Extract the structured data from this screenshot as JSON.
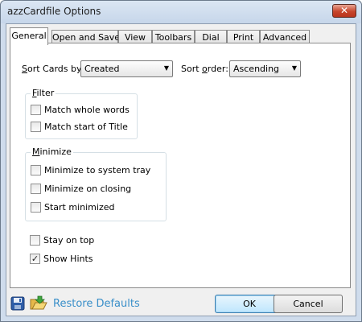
{
  "window": {
    "title": "azzCardfile Options",
    "close_glyph": "✕"
  },
  "tabs": [
    {
      "label": "General"
    },
    {
      "label": "Open and Save"
    },
    {
      "label": "View"
    },
    {
      "label": "Toolbars"
    },
    {
      "label": "Dial"
    },
    {
      "label": "Print"
    },
    {
      "label": "Advanced"
    }
  ],
  "general": {
    "sort_cards": {
      "label_u": "S",
      "label_rest": "ort Cards by:",
      "value": "Created"
    },
    "sort_order": {
      "label_pre": "Sort ",
      "label_u": "o",
      "label_rest": "rder:",
      "value": "Ascending"
    },
    "filter": {
      "title_u": "F",
      "title_rest": "ilter",
      "items": [
        {
          "label": "Match whole words",
          "checked": false
        },
        {
          "label": "Match start of Title",
          "checked": false
        }
      ]
    },
    "minimize": {
      "title_u": "M",
      "title_rest": "inimize",
      "items": [
        {
          "label": "Minimize to system tray",
          "checked": false
        },
        {
          "label": "Minimize on closing",
          "checked": false
        },
        {
          "label": "Start minimized",
          "checked": false
        }
      ]
    },
    "stay_on_top": {
      "label": "Stay on top",
      "checked": false
    },
    "show_hints": {
      "label": "Show Hints",
      "checked": true
    }
  },
  "footer": {
    "restore_label": "Restore Defaults",
    "ok_label": "OK",
    "cancel_label": "Cancel"
  },
  "glyphs": {
    "check": "✓",
    "arrow": "▼"
  },
  "icons": [
    "floppy-disk-icon",
    "open-folder-icon",
    "combo-arrow-icon",
    "checkmark-icon"
  ]
}
